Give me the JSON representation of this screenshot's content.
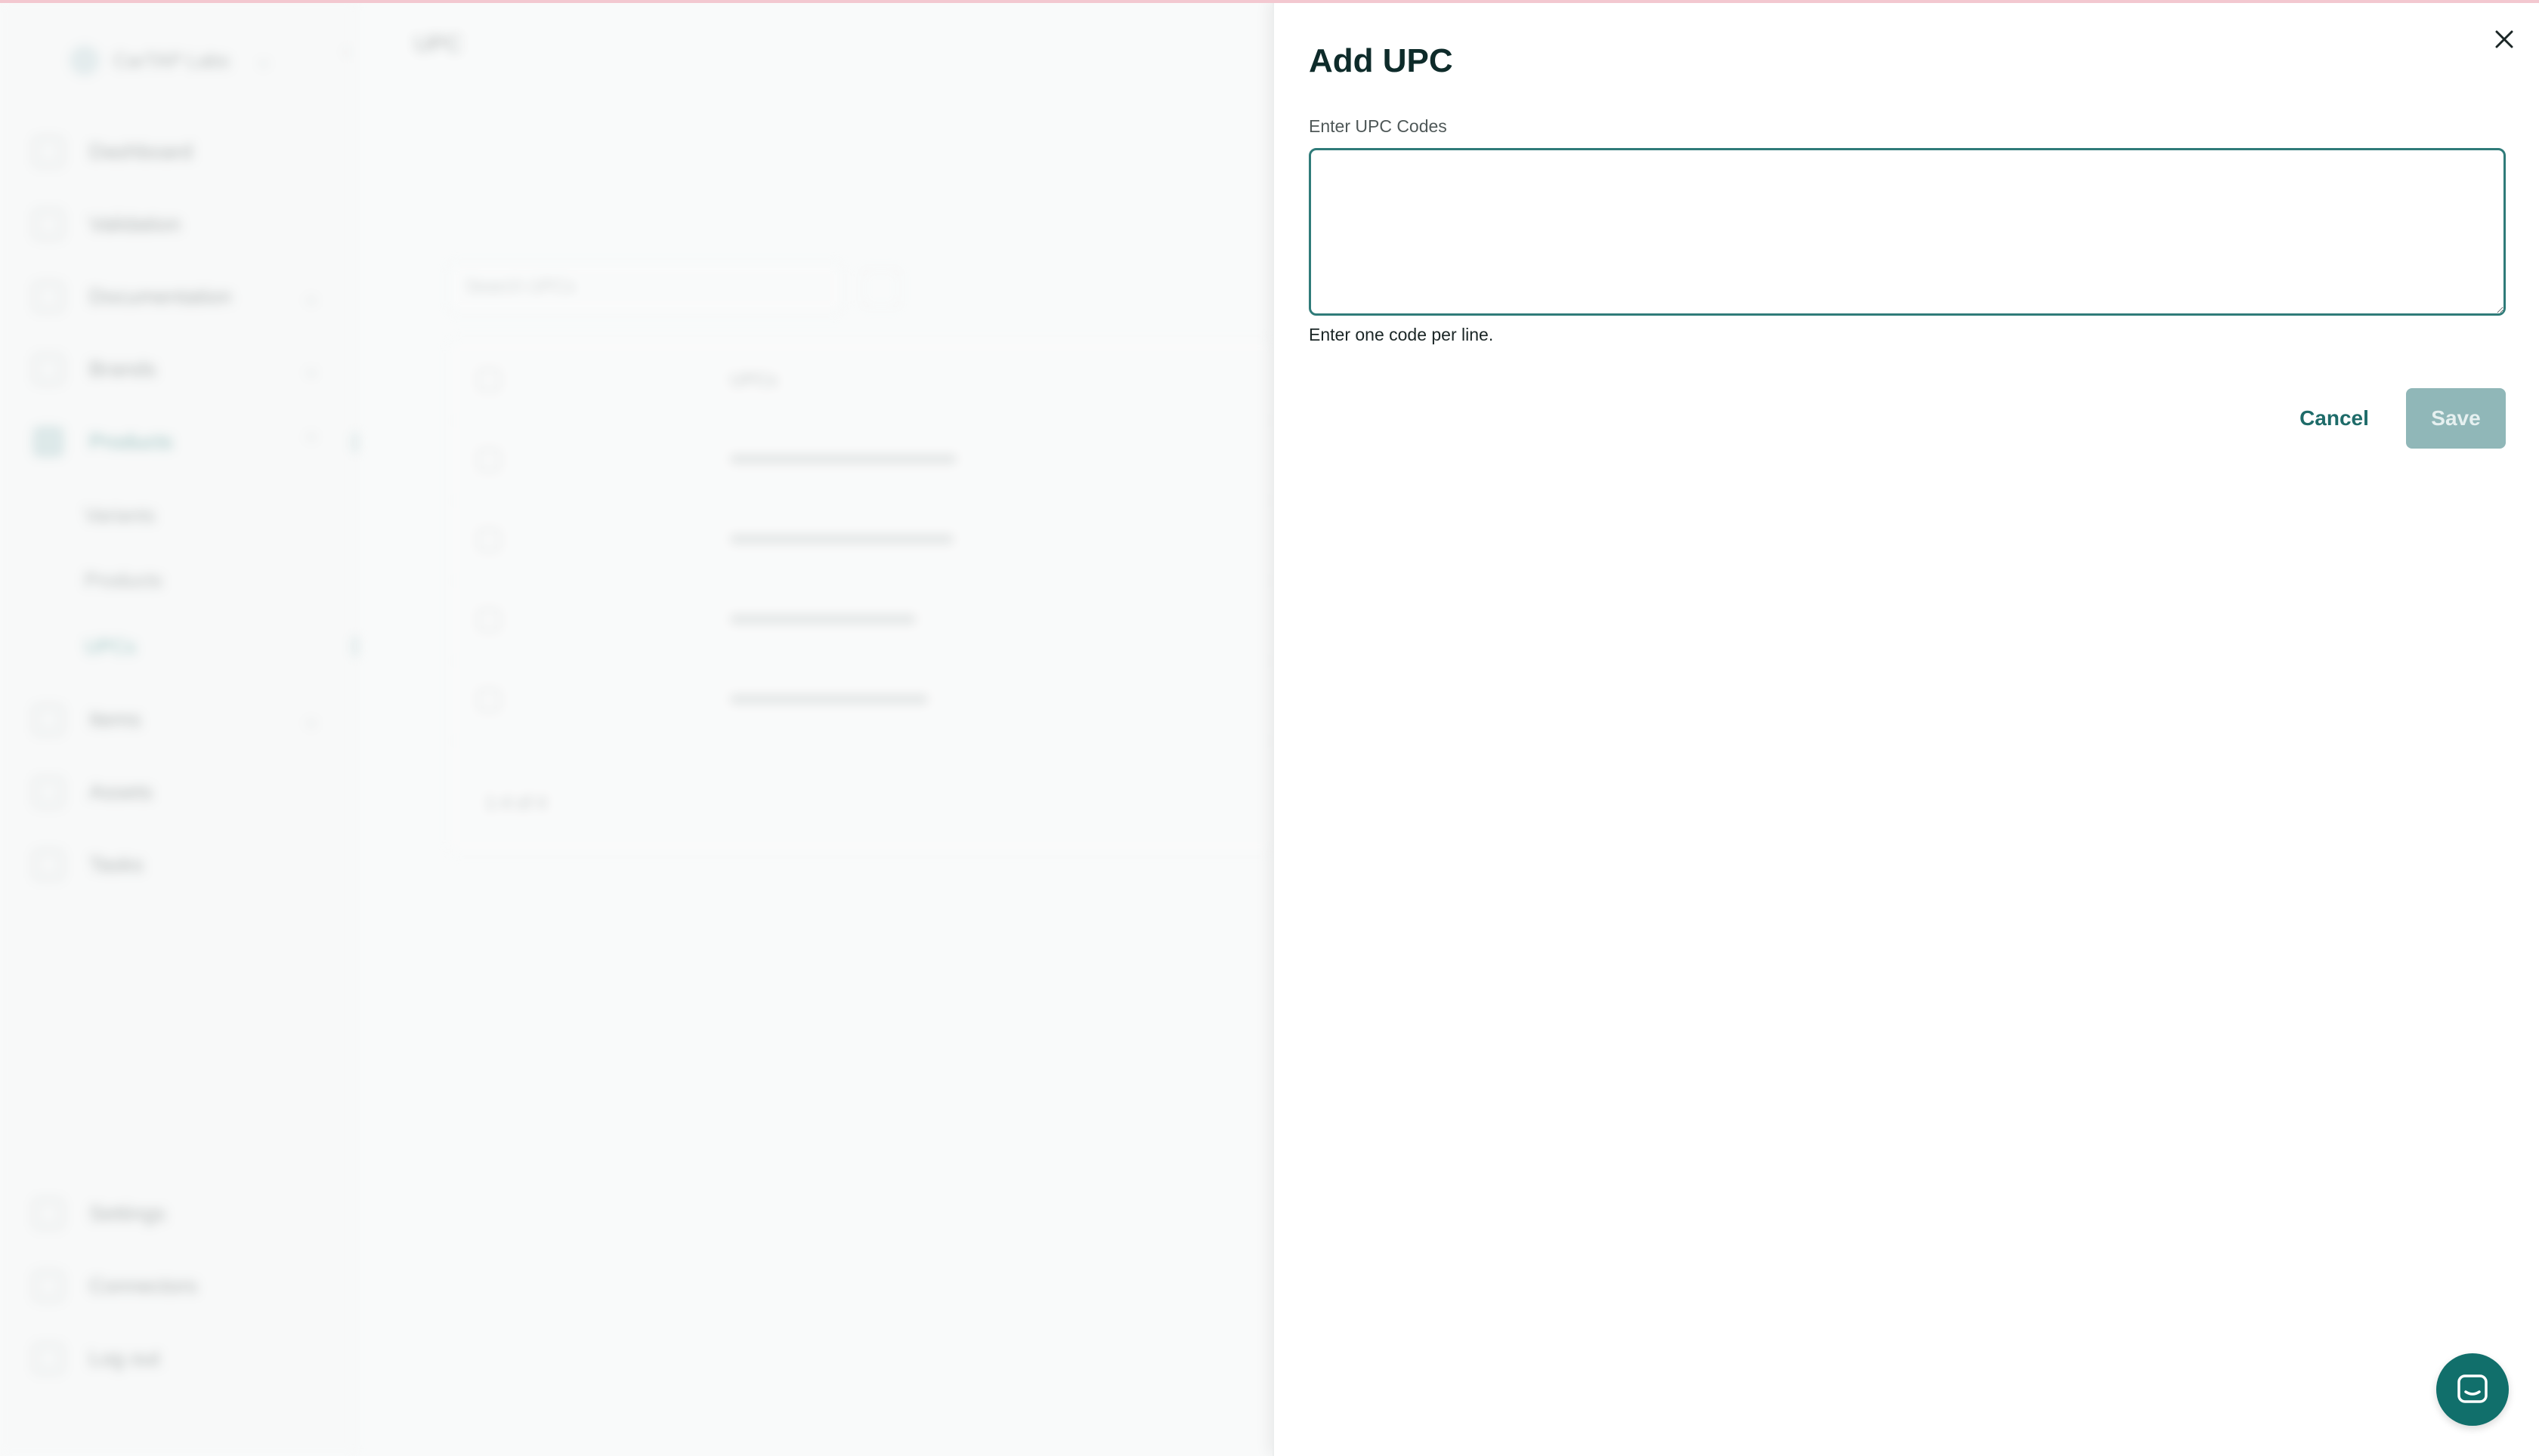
{
  "background": {
    "org_name": "CarTAP Labs",
    "page_title": "UPC",
    "nav": [
      {
        "label": "Dashboard"
      },
      {
        "label": "Validation"
      },
      {
        "label": "Documentation"
      },
      {
        "label": "Brands"
      },
      {
        "label": "Products",
        "active": true
      },
      {
        "label": "Items"
      },
      {
        "label": "Assets"
      },
      {
        "label": "Tasks"
      }
    ],
    "sub_nav": [
      {
        "label": "Variants"
      },
      {
        "label": "Products"
      },
      {
        "label": "UPCs",
        "active": true
      }
    ],
    "bottom_nav": [
      {
        "label": "Settings"
      },
      {
        "label": "Connectors"
      },
      {
        "label": "Log out"
      }
    ],
    "search_placeholder": "Search UPCs",
    "table_header": "UPCs",
    "table_footer": "1-4 of 4"
  },
  "drawer": {
    "title": "Add UPC",
    "field_label": "Enter UPC Codes",
    "field_value": "",
    "helper_text": "Enter one code per line.",
    "cancel_label": "Cancel",
    "save_label": "Save"
  },
  "colors": {
    "accent": "#116f6b",
    "title": "#0e2b2a",
    "input_border": "#2f7b79",
    "save_disabled": "#90b7b8"
  },
  "icons": {
    "close": "close-icon",
    "chat": "chat-icon"
  }
}
